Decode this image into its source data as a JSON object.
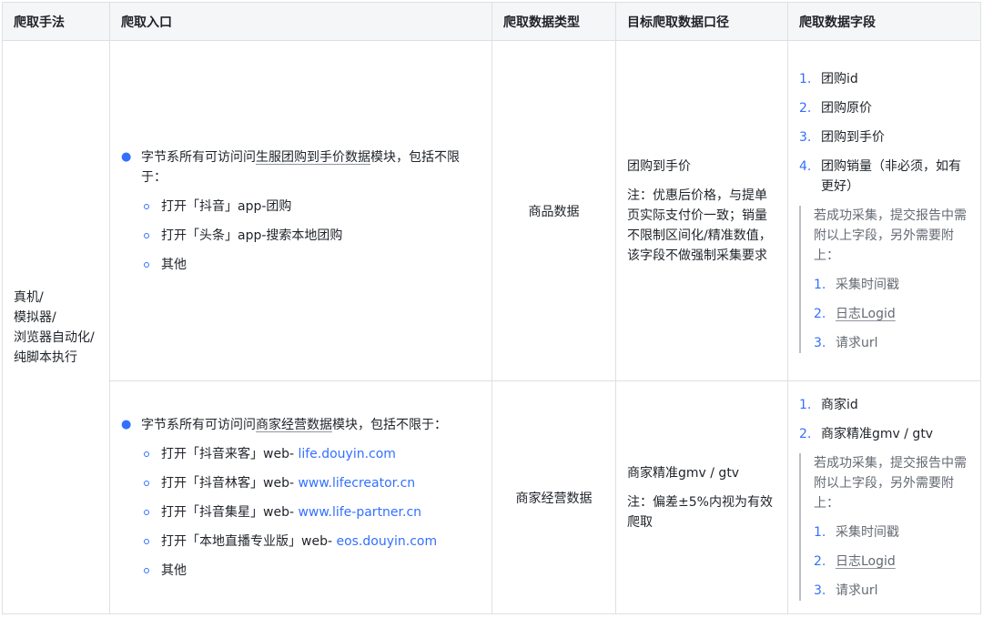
{
  "headers": [
    "爬取手法",
    "爬取入口",
    "爬取数据类型",
    "目标爬取数据口径",
    "爬取数据字段"
  ],
  "method": [
    "真机/",
    "模拟器/",
    "浏览器自动化/",
    "纯脚本执行"
  ],
  "row1": {
    "entry_prefix": "字节系所有可访问问",
    "entry_link": "生服团购到手价数据",
    "entry_suffix": "模块，包括不限于：",
    "sub": [
      {
        "text": "打开「抖音」app-团购",
        "url": ""
      },
      {
        "text": "打开「头条」app-搜索本地团购",
        "url": ""
      },
      {
        "text": "其他",
        "url": ""
      }
    ],
    "type": "商品数据",
    "scope_title": "团购到手价",
    "scope_note": "注：优惠后价格，与提单页实际支付价一致；销量不限制区间化/精准数值，该字段不做强制采集要求",
    "fields": [
      "团购id",
      "团购原价",
      "团购到手价",
      "团购销量（非必须，如有更好）"
    ],
    "quote_text": "若成功采集，提交报告中需附以上字段，另外需要附上：",
    "extra": [
      "采集时间戳",
      "日志Logid",
      "请求url"
    ]
  },
  "row2": {
    "entry_prefix": "字节系所有可访问问",
    "entry_link": "商家经营数据",
    "entry_suffix": "模块，包括不限于：",
    "sub": [
      {
        "text": "打开「抖音来客」web- ",
        "url": "life.douyin.com"
      },
      {
        "text": "打开「抖音林客」web- ",
        "url": "www.lifecreator.cn"
      },
      {
        "text": "打开「抖音集星」web- ",
        "url": "www.life-partner.cn"
      },
      {
        "text": "打开「本地直播专业版」web- ",
        "url": "eos.douyin.com"
      },
      {
        "text": "其他",
        "url": ""
      }
    ],
    "type": "商家经营数据",
    "scope_title": "商家精准gmv / gtv",
    "scope_note": "注：偏差±5%内视为有效爬取",
    "fields": [
      "商家id",
      "商家精准gmv / gtv"
    ],
    "quote_text": "若成功采集，提交报告中需附以上字段，另外需要附上：",
    "extra": [
      "采集时间戳",
      "日志Logid",
      "请求url"
    ]
  }
}
